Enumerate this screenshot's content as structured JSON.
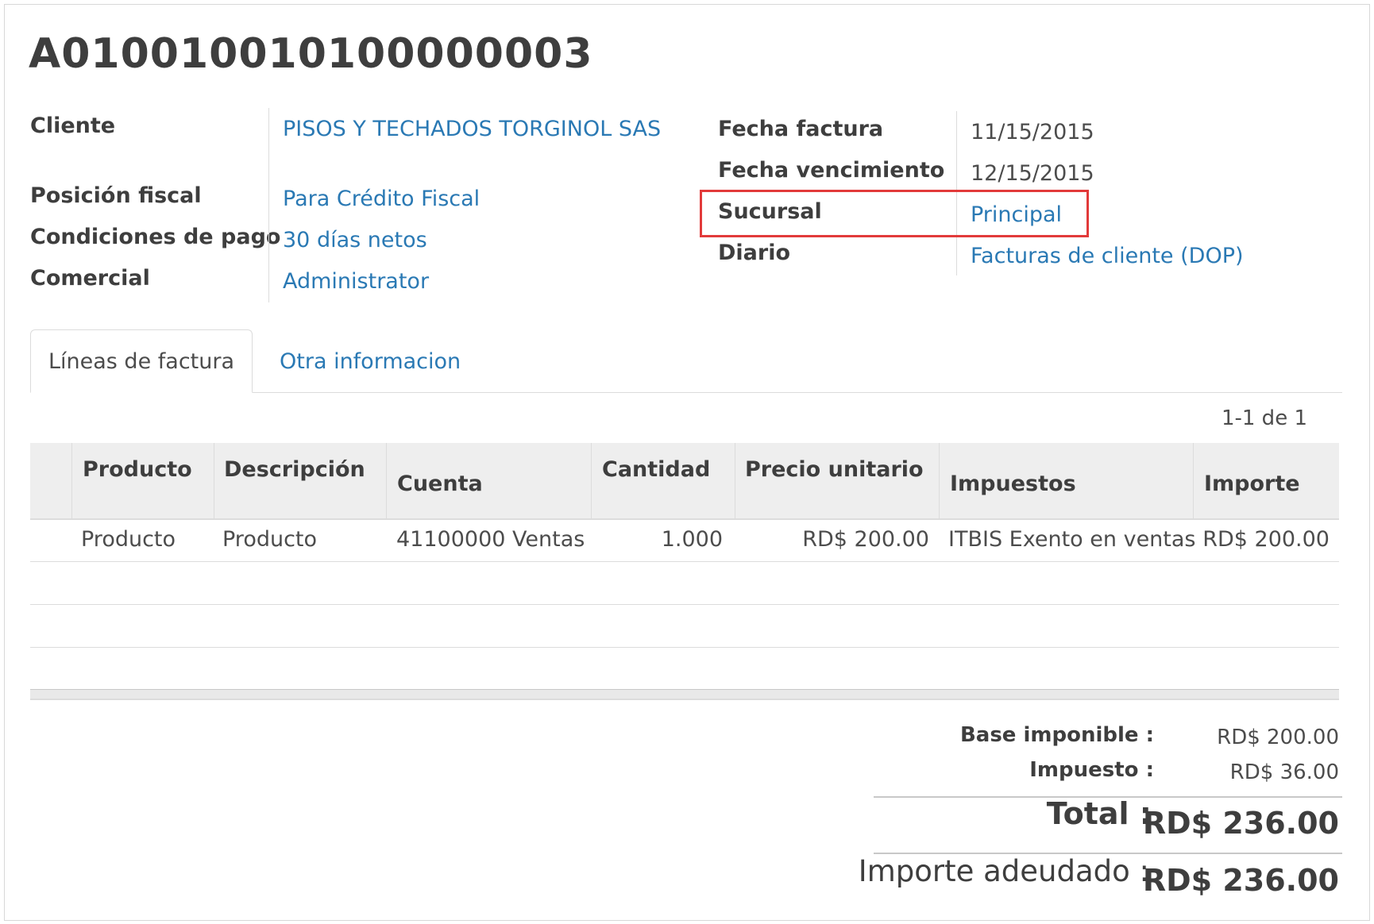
{
  "invoice": {
    "number": "A010010010100000003"
  },
  "left_fields": [
    {
      "label": "Cliente",
      "value": "PISOS Y TECHADOS TORGINOL SAS"
    },
    {
      "label": "Posición fiscal",
      "value": "Para Crédito Fiscal"
    },
    {
      "label": "Condiciones de pago",
      "value": "30 días netos"
    },
    {
      "label": "Comercial",
      "value": "Administrator"
    }
  ],
  "right_fields": [
    {
      "label": "Fecha factura",
      "value": "11/15/2015"
    },
    {
      "label": "Fecha vencimiento",
      "value": "12/15/2015"
    },
    {
      "label": "Sucursal",
      "value": "Principal"
    },
    {
      "label": "Diario",
      "value": "Facturas de cliente (DOP)"
    }
  ],
  "tabs": [
    {
      "label": "Líneas de factura",
      "active": true
    },
    {
      "label": "Otra informacion",
      "active": false
    }
  ],
  "pager": "1-1 de 1",
  "table": {
    "headers": [
      "Producto",
      "Descripción",
      "Cuenta",
      "Cantidad",
      "Precio unitario",
      "Impuestos",
      "Importe"
    ],
    "rows": [
      [
        "Producto",
        "Producto",
        "41100000 Ventas",
        "1.000",
        "RD$ 200.00",
        "ITBIS Exento en ventas",
        "RD$ 200.00"
      ]
    ]
  },
  "totals": {
    "base_label": "Base imponible :",
    "base_value": "RD$ 200.00",
    "tax_label": "Impuesto :",
    "tax_value": "RD$ 36.00",
    "total_label": "Total :",
    "total_value": "RD$ 236.00",
    "due_label": "Importe adeudado :",
    "due_value": "RD$ 236.00"
  },
  "colors": {
    "link": "#2a79b4",
    "highlight": "#e23a3a",
    "header_bg": "#eeeeee"
  }
}
